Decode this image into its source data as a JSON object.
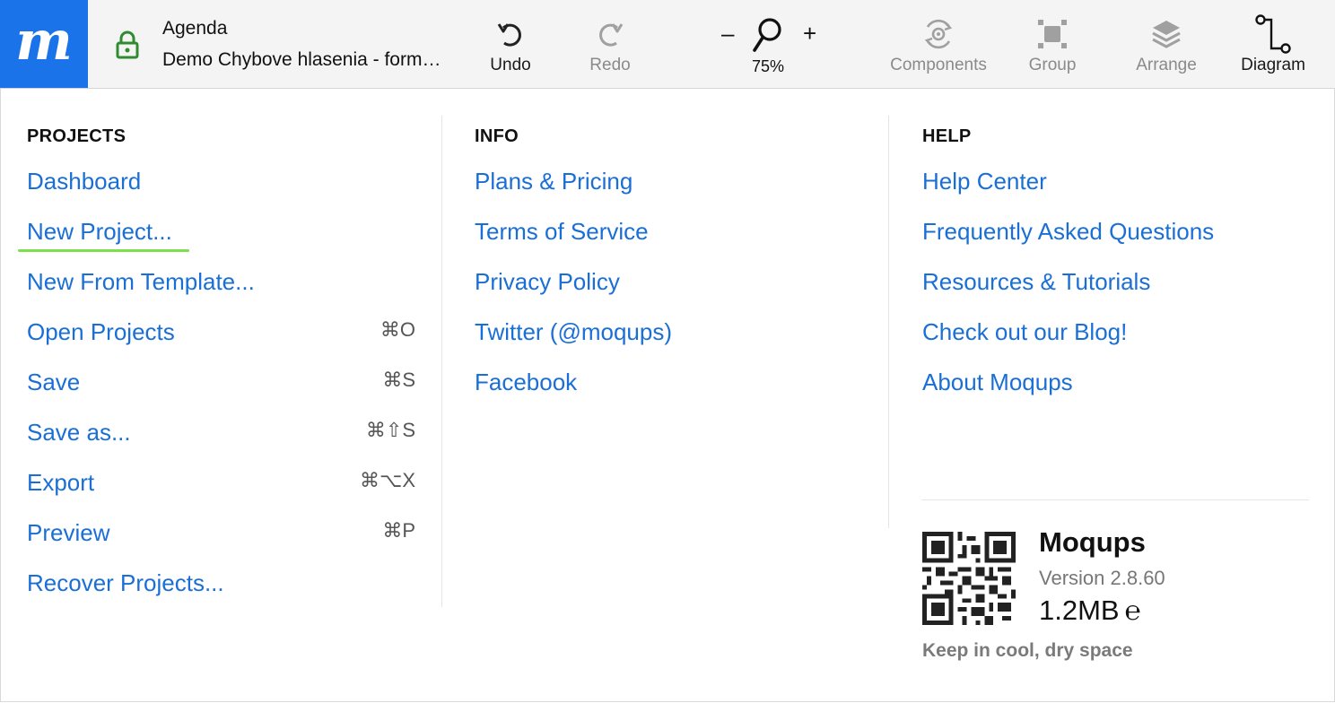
{
  "app": {
    "logo_letter": "m",
    "brand_color": "#1a73e8"
  },
  "document": {
    "title": "Agenda",
    "subtitle": "Demo Chybove hlasenia - formular",
    "locked": true
  },
  "toolbar": {
    "undo": "Undo",
    "redo": "Redo",
    "zoom_minus": "–",
    "zoom_plus": "+",
    "zoom_level": "75%",
    "components": "Components",
    "group": "Group",
    "arrange": "Arrange",
    "diagram": "Diagram"
  },
  "menu": {
    "projects": {
      "heading": "PROJECTS",
      "items": [
        {
          "label": "Dashboard",
          "shortcut": ""
        },
        {
          "label": "New Project...",
          "shortcut": ""
        },
        {
          "label": "New From Template...",
          "shortcut": ""
        },
        {
          "label": "Open Projects",
          "shortcut": "⌘O"
        },
        {
          "label": "Save",
          "shortcut": "⌘S"
        },
        {
          "label": "Save as...",
          "shortcut": "⌘⇧S"
        },
        {
          "label": "Export",
          "shortcut": "⌘⌥X"
        },
        {
          "label": "Preview",
          "shortcut": "⌘P"
        },
        {
          "label": "Recover Projects...",
          "shortcut": ""
        }
      ]
    },
    "info": {
      "heading": "INFO",
      "items": [
        {
          "label": "Plans & Pricing"
        },
        {
          "label": "Terms of Service"
        },
        {
          "label": "Privacy Policy"
        },
        {
          "label": "Twitter (@moqups)"
        },
        {
          "label": "Facebook"
        }
      ]
    },
    "help": {
      "heading": "HELP",
      "items": [
        {
          "label": "Help Center"
        },
        {
          "label": "Frequently Asked Questions"
        },
        {
          "label": "Resources & Tutorials"
        },
        {
          "label": "Check out our Blog!"
        },
        {
          "label": "About Moqups"
        }
      ]
    },
    "about": {
      "brand": "Moqups",
      "version": "Version 2.8.60",
      "size": "1.2MB",
      "size_suffix": "℮",
      "tagline": "Keep in cool, dry space"
    }
  },
  "colors": {
    "link": "#1a6fd6",
    "active_underline": "#7be04a",
    "lock": "#2e8b2e"
  }
}
